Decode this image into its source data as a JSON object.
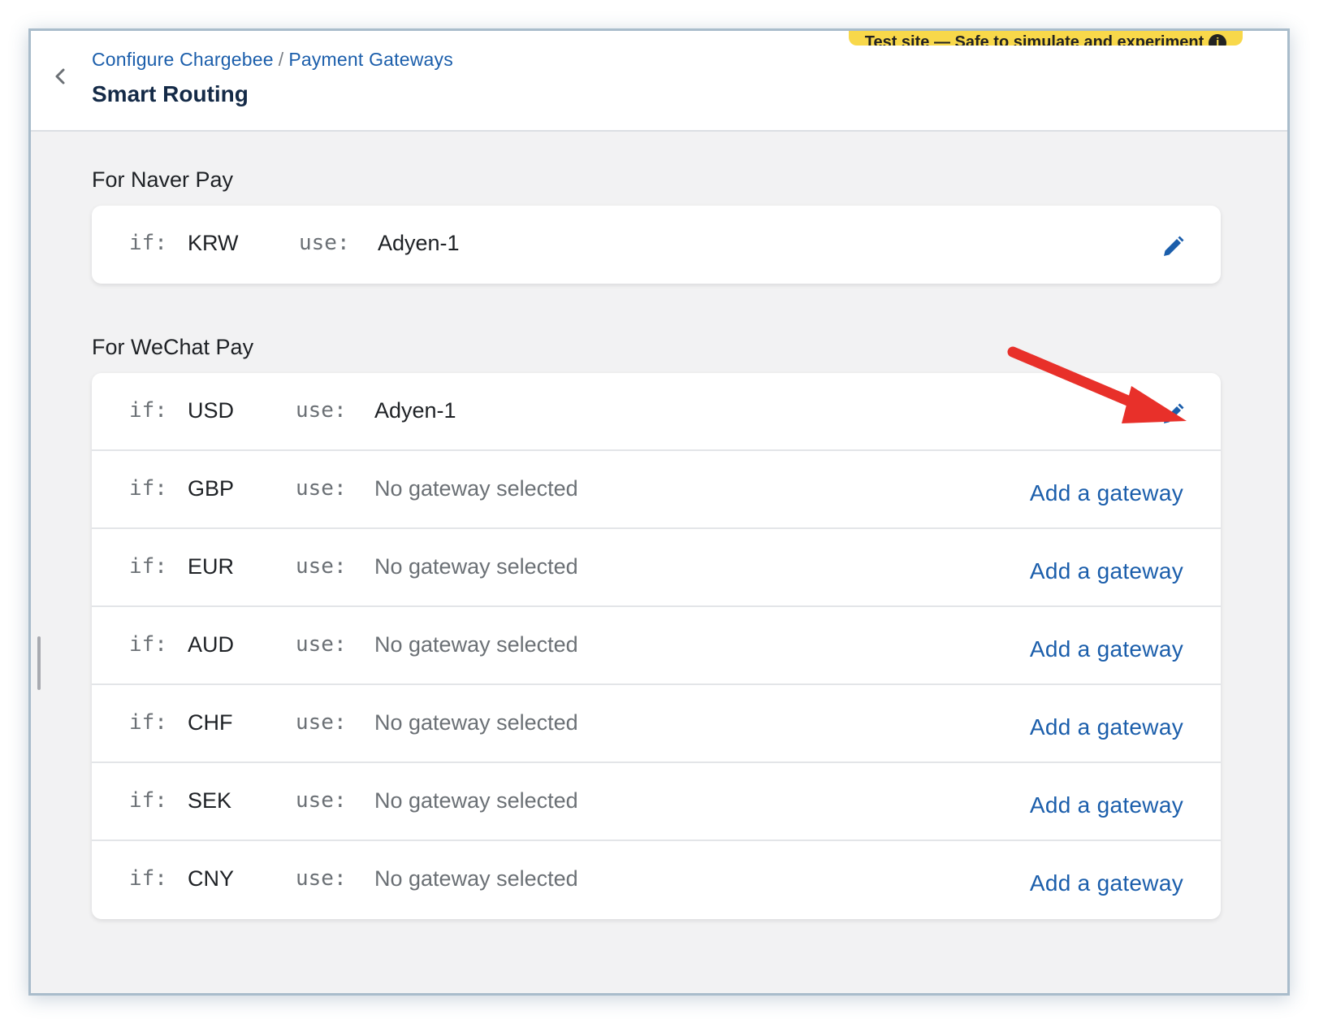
{
  "header": {
    "breadcrumb": [
      "Configure Chargebee",
      "Payment Gateways"
    ],
    "breadcrumb_separator": "/",
    "title": "Smart Routing",
    "test_banner": "Test site — Safe to simulate and experiment"
  },
  "labels": {
    "if": "if:",
    "use": "use:"
  },
  "sections": [
    {
      "title": "For Naver Pay",
      "rows": [
        {
          "currency": "KRW",
          "gateway": "Adyen-1",
          "action": "edit"
        }
      ]
    },
    {
      "title": "For WeChat Pay",
      "rows": [
        {
          "currency": "USD",
          "gateway": "Adyen-1",
          "action": "edit"
        },
        {
          "currency": "GBP",
          "gateway": "No gateway selected",
          "action": "Add a gateway"
        },
        {
          "currency": "EUR",
          "gateway": "No gateway selected",
          "action": "Add a gateway"
        },
        {
          "currency": "AUD",
          "gateway": "No gateway selected",
          "action": "Add a gateway"
        },
        {
          "currency": "CHF",
          "gateway": "No gateway selected",
          "action": "Add a gateway"
        },
        {
          "currency": "SEK",
          "gateway": "No gateway selected",
          "action": "Add a gateway"
        },
        {
          "currency": "CNY",
          "gateway": "No gateway selected",
          "action": "Add a gateway"
        }
      ]
    }
  ],
  "icons": {
    "back": "chevron-left-icon",
    "edit": "pencil-icon",
    "annotation": "red-arrow"
  },
  "colors": {
    "link": "#1b5eab",
    "title": "#142a47",
    "banner": "#f8d84a",
    "arrow": "#e8302a"
  }
}
